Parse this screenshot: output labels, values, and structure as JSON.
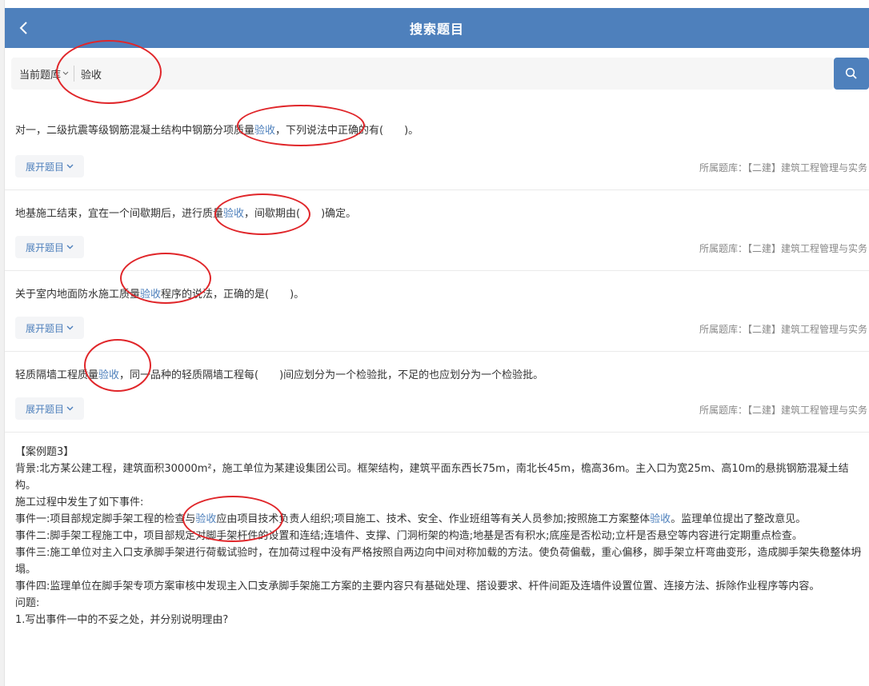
{
  "header": {
    "title": "搜索题目"
  },
  "search": {
    "library_label": "当前题库",
    "query": "验收"
  },
  "questions": [
    {
      "before": "对一，二级抗震等级钢筋混凝土结构中钢筋分项质量",
      "highlight": "验收",
      "after": "，下列说法中正确的有(　　)。",
      "expand_label": "展开题目",
      "meta": "所属题库：【二建】建筑工程管理与实务"
    },
    {
      "before": "地基施工结束，宜在一个间歇期后，进行质量",
      "highlight": "验收",
      "after": "，间歇期由(　　)确定。",
      "expand_label": "展开题目",
      "meta": "所属题库：【二建】建筑工程管理与实务"
    },
    {
      "before": "关于室内地面防水施工质量",
      "highlight": "验收",
      "after": "程序的说法，正确的是(　　)。",
      "expand_label": "展开题目",
      "meta": "所属题库：【二建】建筑工程管理与实务"
    },
    {
      "before": "轻质隔墙工程质量",
      "highlight": "验收",
      "after": "，同一品种的轻质隔墙工程每(　　)间应划分为一个检验批，不足的也应划分为一个检验批。",
      "expand_label": "展开题目",
      "meta": "所属题库：【二建】建筑工程管理与实务"
    }
  ],
  "case": {
    "title": "【案例题3】",
    "background": "背景:北方某公建工程，建筑面积30000m²，施工单位为某建设集团公司。框架结构，建筑平面东西长75m，南北长45m，檐高36m。主入口为宽25m、高10m的悬挑钢筋混凝土结构。",
    "process": "施工过程中发生了如下事件:",
    "event1_a": "事件一:项目部规定脚手架工程的检查与",
    "event1_hl1": "验收",
    "event1_b": "应由项目技术负责人组织;项目施工、技术、安全、作业班组等有关人员参加;按照施工方案整体",
    "event1_hl2": "验收",
    "event1_c": "。监理单位提出了整改意见。",
    "event2": "事件二:脚手架工程施工中，项目部规定对脚手架杆件的设置和连结;连墙件、支撑、门洞桁架的构造;地基是否有积水;底座是否松动;立杆是否悬空等内容进行定期重点检查。",
    "event3": "事件三:施工单位对主入口支承脚手架进行荷载试验时，在加荷过程中没有严格按照自两边向中间对称加载的方法。使负荷偏载，重心偏移，脚手架立杆弯曲变形，造成脚手架失稳整体坍塌。",
    "event4": "事件四:监理单位在脚手架专项方案审核中发现主入口支承脚手架施工方案的主要内容只有基础处理、搭设要求、杆件间距及连墙件设置位置、连接方法、拆除作业程序等内容。",
    "question_label": "问题:",
    "q1": "1.写出事件一中的不妥之处，并分别说明理由?"
  },
  "icons": {
    "back": "chevron-left-icon",
    "search": "search-icon",
    "expand": "chevron-down-icon"
  },
  "colors": {
    "accent": "#4e80bc",
    "annotation": "#e0262a"
  }
}
